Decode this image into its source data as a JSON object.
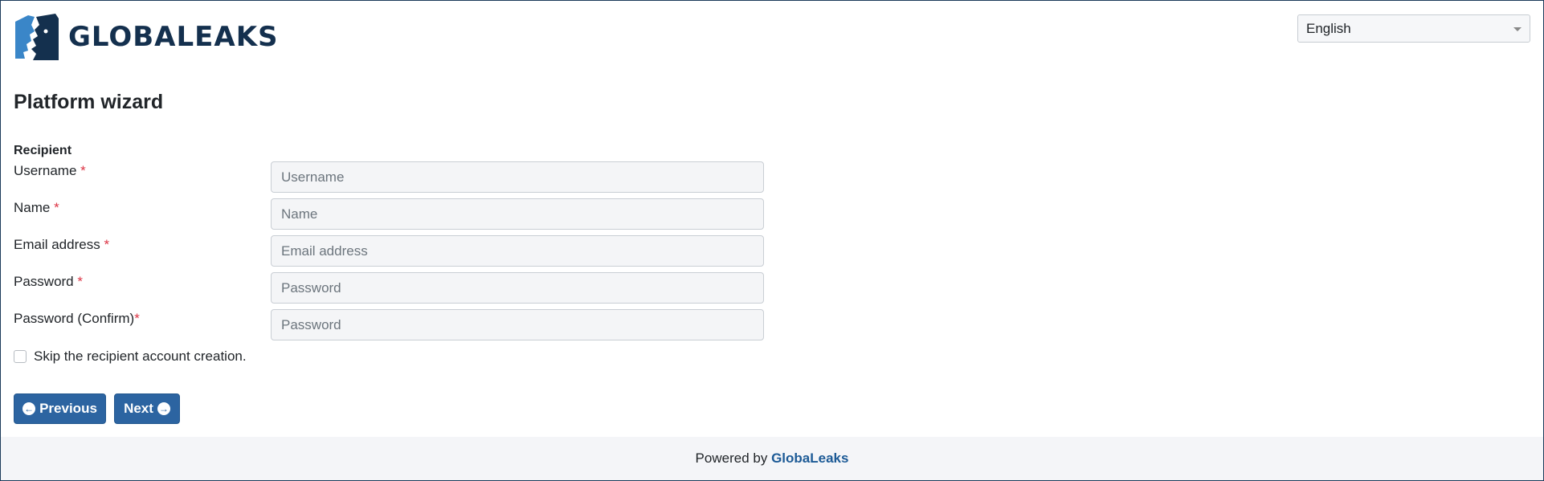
{
  "header": {
    "logo_text": "GLOBALEAKS",
    "language": {
      "selected": "English"
    }
  },
  "page": {
    "title": "Platform wizard"
  },
  "form": {
    "section_label": "Recipient",
    "fields": [
      {
        "label": "Username",
        "required_mark": "*",
        "placeholder": "Username",
        "value": ""
      },
      {
        "label": "Name",
        "required_mark": "*",
        "placeholder": "Name",
        "value": ""
      },
      {
        "label": "Email address",
        "required_mark": "*",
        "placeholder": "Email address",
        "value": ""
      },
      {
        "label": "Password",
        "required_mark": "*",
        "placeholder": "Password",
        "value": ""
      },
      {
        "label": "Password (Confirm)",
        "required_mark": "*",
        "placeholder": "Password",
        "value": ""
      }
    ],
    "skip_checkbox": {
      "label": "Skip the recipient account creation.",
      "checked": false
    }
  },
  "buttons": {
    "previous_label": "Previous",
    "next_label": "Next"
  },
  "footer": {
    "prefix": "Powered by",
    "link_text": "GlobaLeaks"
  },
  "colors": {
    "primary": "#2c64a1",
    "logo_dark": "#14304e",
    "logo_light": "#3a86c8",
    "required": "#dc3545"
  }
}
